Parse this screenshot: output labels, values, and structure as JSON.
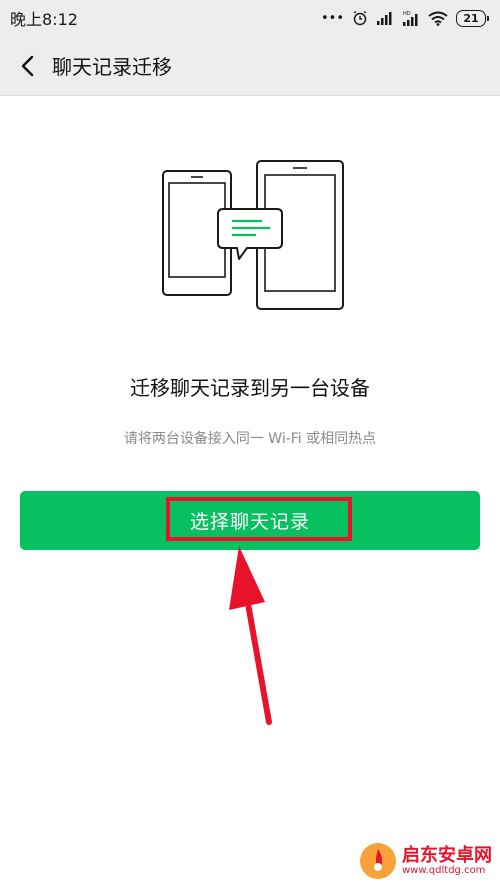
{
  "status_bar": {
    "time": "晚上8:12",
    "dots": "•••",
    "battery": "21",
    "icons": [
      "alarm-icon",
      "signal-icon",
      "hd-signal-icon",
      "wifi-icon",
      "battery-icon"
    ]
  },
  "nav": {
    "title": "聊天记录迁移",
    "back_icon": "chevron-left-icon"
  },
  "main": {
    "title": "迁移聊天记录到另一台设备",
    "subtitle": "请将两台设备接入同一 Wi-Fi 或相同热点",
    "button_label": "选择聊天记录"
  },
  "colors": {
    "accent": "#07c160",
    "highlight": "#e8132a",
    "nav_bg": "#ededed"
  },
  "watermark": {
    "name": "启东安卓网",
    "url": "www.qdltdg.com"
  }
}
